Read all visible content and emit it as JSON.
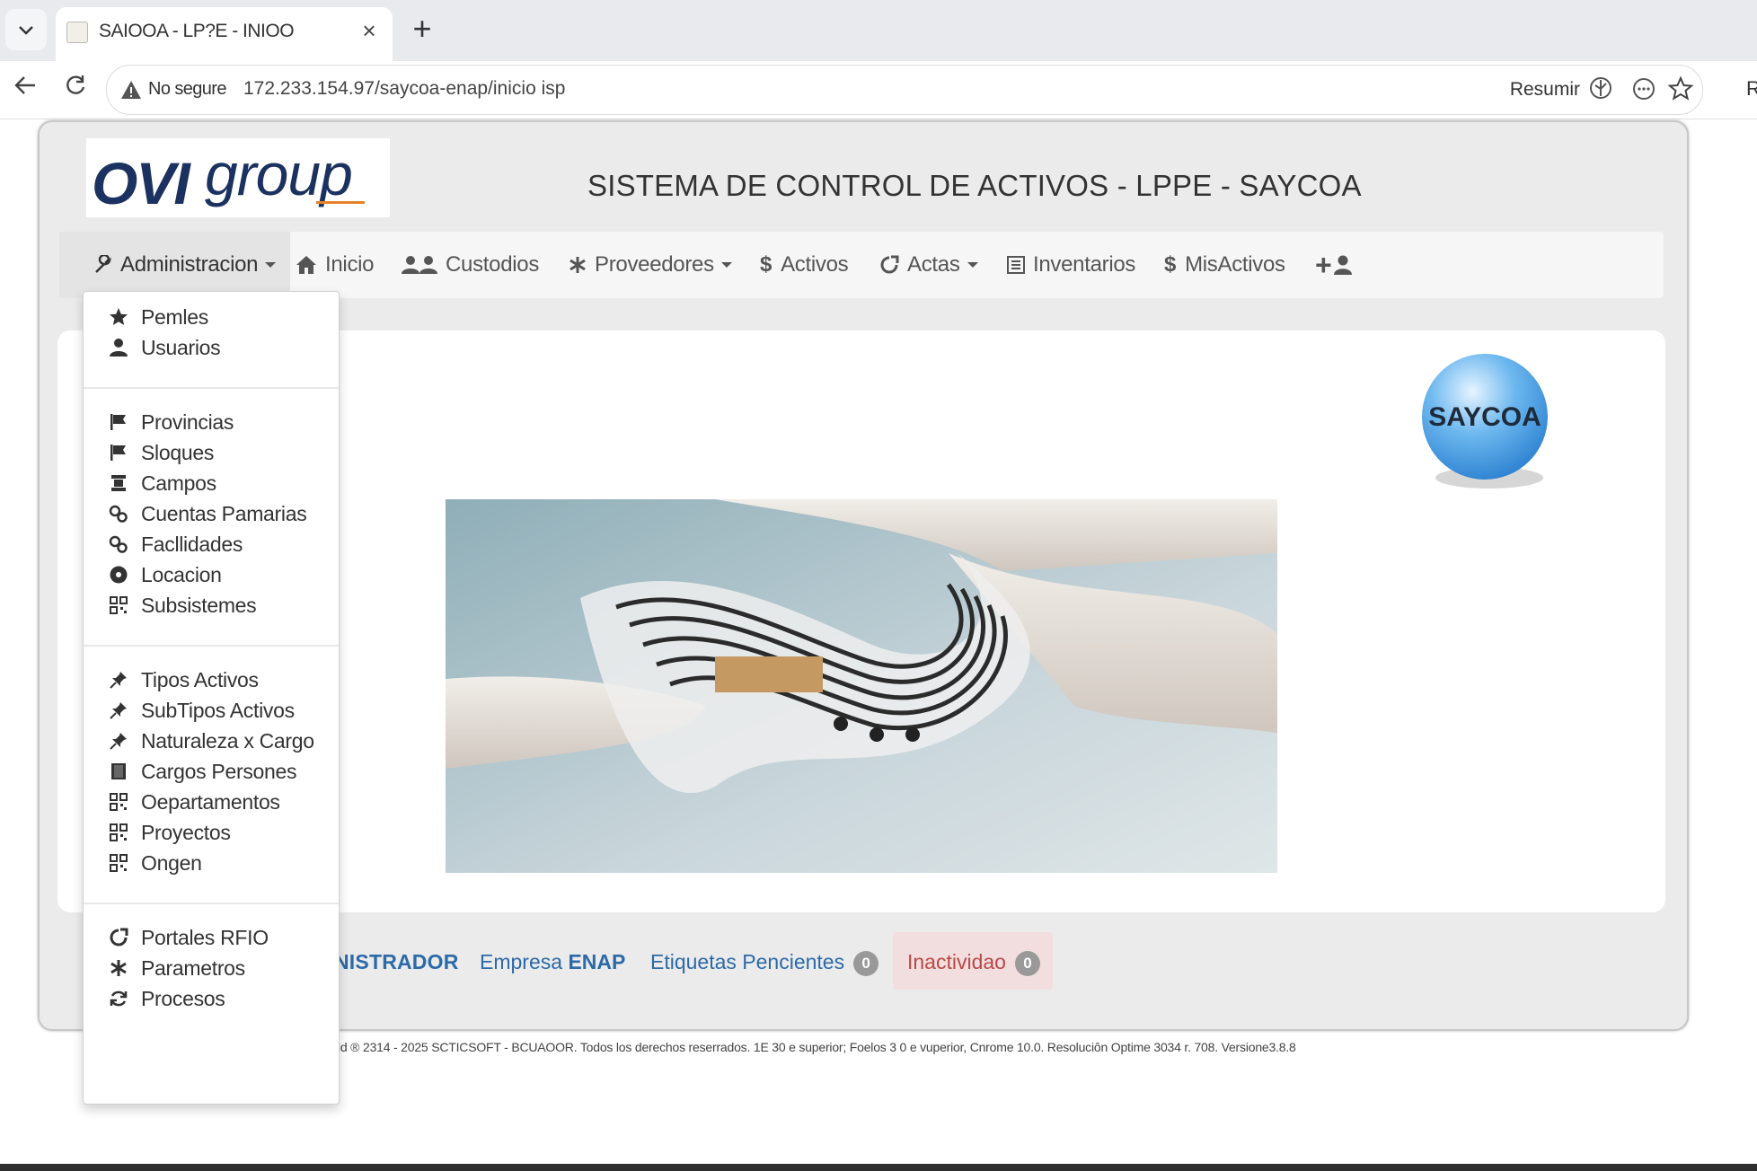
{
  "browser": {
    "tab_title": "SAIOOA - LP?E - INIOO",
    "close_glyph": "×",
    "new_tab_glyph": "+",
    "not_secure": "No segure",
    "url": "172.233.154.97/saycoa-enap/inicio isp",
    "resumir": "Resumir",
    "edge_letter": "R"
  },
  "header": {
    "logo_ovi": "OVI",
    "logo_group": "group",
    "system_title": "SISTEMA DE CONTROL DE ACTIVOS - LPPE - SAYCOA",
    "saycoa_logo_text": "SAYCOA"
  },
  "nav": {
    "administracion": "Administracion",
    "inicio": "Inicio",
    "custodios": "Custodios",
    "proveedores": "Proveedores",
    "activos": "Activos",
    "actas": "Actas",
    "inventarios": "Inventarios",
    "mis_activos": "MisActivos",
    "dollar": "$",
    "add_user_glyph": "+"
  },
  "dropdown": {
    "group1": [
      "Pemles",
      "Usuarios"
    ],
    "group2": [
      "Provincias",
      "Sloques",
      "Campos",
      "Cuentas Pamarias",
      "Facllidades",
      "Locacion",
      "Subsistemes"
    ],
    "group3": [
      "Tipos Activos",
      "SubTipos Activos",
      "Naturaleza x Cargo",
      "Cargos Persones",
      "Oepartamentos",
      "Proyectos",
      "Ongen"
    ],
    "group4": [
      "Portales RFIO",
      "Parametros",
      "Procesos"
    ]
  },
  "status": {
    "role": "NISTRADOR",
    "empresa_label": "Empresa",
    "empresa_value": "ENAP",
    "etiquetas": "Etiquetas Pencientes",
    "etiquetas_count": "0",
    "inactividad": "Inactividao",
    "inactividad_count": "0"
  },
  "footer": {
    "text": "ld ® 2314 - 2025 SCTICSOFT - BCUAOOR. Todos los derechos reserrados. 1E 30 e superior; Foelos 3 0 e vuperior, Cnrome 10.0. Resoluciôn Optime 3034 r. 708. Versione3.8.8"
  },
  "colors": {
    "link_blue": "#2c6aa8",
    "danger_red": "#b94a48",
    "logo_navy": "#1b3260",
    "saycoa_blue": "#3d9be0"
  }
}
